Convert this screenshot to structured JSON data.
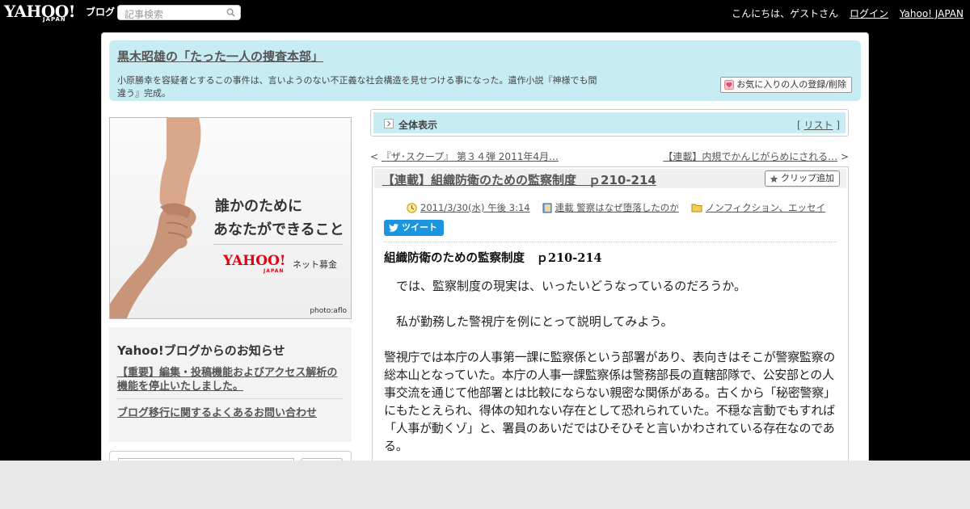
{
  "topbar": {
    "logo_text": "YAHOO!",
    "logo_sub": "JAPAN",
    "blog_label": "ブログ",
    "search_placeholder": "記事検索",
    "greeting": "こんにちは、ゲストさん",
    "login": "ログイン",
    "yahoo_japan": "Yahoo! JAPAN"
  },
  "header": {
    "title": "黒木昭雄の「たった一人の捜査本部」",
    "description": "小原勝幸を容疑者とするこの事件は、言いようのない不正義な社会構造を見せつける事になった。遺作小説『神様でも間違う』完成。",
    "fav_button": "お気に入りの人の登録/削除"
  },
  "ad": {
    "line1": "誰かのために",
    "line2": "あなたができること",
    "logo": "YAHOO!",
    "logo_sub": "JAPAN",
    "tag": "ネット募金",
    "credit": "photo:aflo"
  },
  "notice": {
    "heading": "Yahoo!ブログからのお知らせ",
    "items": [
      "【重要】編集・投稿機能およびアクセス解析の機能を停止いたしました。",
      "ブログ移行に関するよくあるお問い合わせ"
    ]
  },
  "viewbar": {
    "label": "全体表示",
    "list_open": "[",
    "list_link": "リスト",
    "list_close": "]"
  },
  "postnav": {
    "prev_arrow": "<",
    "prev": "『ザ･スクープ』 第３４弾 2011年4月…",
    "next": "【連載】内規でかんじがらめにされる…",
    "next_arrow": ">"
  },
  "article": {
    "title": "【連載】組織防衛のための監察制度　ｐ210-214",
    "clip_button": "クリップ追加",
    "date": "2011/3/30(水) 午後 3:14",
    "category": "連載 警察はなぜ堕落したのか",
    "genre": "ノンフィクション、エッセイ",
    "tweet": "ツイート",
    "heading": "組織防衛のための監察制度　ｐ210-214",
    "paragraphs": [
      "　では、監察制度の現実は、いったいどうなっているのだろうか。",
      "　私が勤務した警視庁を例にとって説明してみよう。",
      "警視庁では本庁の人事第一課に監察係という部署があり、表向きはそこが警察監察の総本山となっていた。本庁の人事一課監察係は警務部長の直轄部隊で、公安部との人事交流を通じて他部署とは比較にならない親密な関係がある。古くから「秘密警察」にもたとえられ、得体の知れない存在として恐れられていた。不穏な言動でもすれば「人事が動くゾ」と、署員のあいだではひそひそと言いかわされている存在なのである。"
    ]
  },
  "colors": {
    "header_bg": "#c8ecf4",
    "tweet_bg": "#1b95e0",
    "brand_red": "#e60012"
  }
}
